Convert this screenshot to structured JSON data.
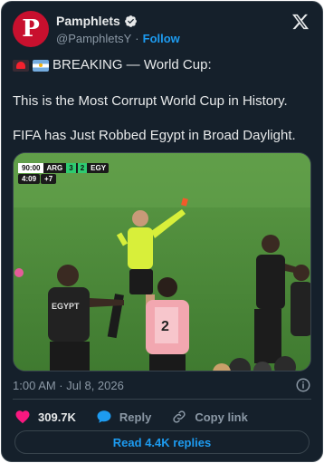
{
  "author": {
    "display_name": "Pamphlets",
    "avatar_letter": "P",
    "handle": "@PamphletsY",
    "separator": "·",
    "follow_label": "Follow",
    "brand_color": "#c8102e"
  },
  "post": {
    "line1_text": "BREAKING — World Cup:",
    "line1_icons": [
      "police-light-emoji",
      "argentina-flag-emoji"
    ],
    "paragraph2": "This is the Most Corrupt World Cup in History.",
    "paragraph3": "FIFA has Just Robbed Egypt in Broad Daylight.",
    "timestamp": "1:00 AM · Jul 8, 2026"
  },
  "media": {
    "scorebug": {
      "time": "90:00",
      "team_left": "ARG",
      "score_left": "3",
      "score_right": "2",
      "team_right": "EGY",
      "extra_time": "4:09",
      "added": "+7"
    },
    "shirt_text": "EGYPT",
    "bib_number": "2"
  },
  "actions": {
    "like_count": "309.7K",
    "reply_label": "Reply",
    "copy_link_label": "Copy link"
  },
  "replies_button": "Read 4.4K replies",
  "colors": {
    "background": "#15202b",
    "accent": "#1d9bf0",
    "like": "#f91880",
    "muted": "#8b98a5",
    "border": "#38444d"
  }
}
